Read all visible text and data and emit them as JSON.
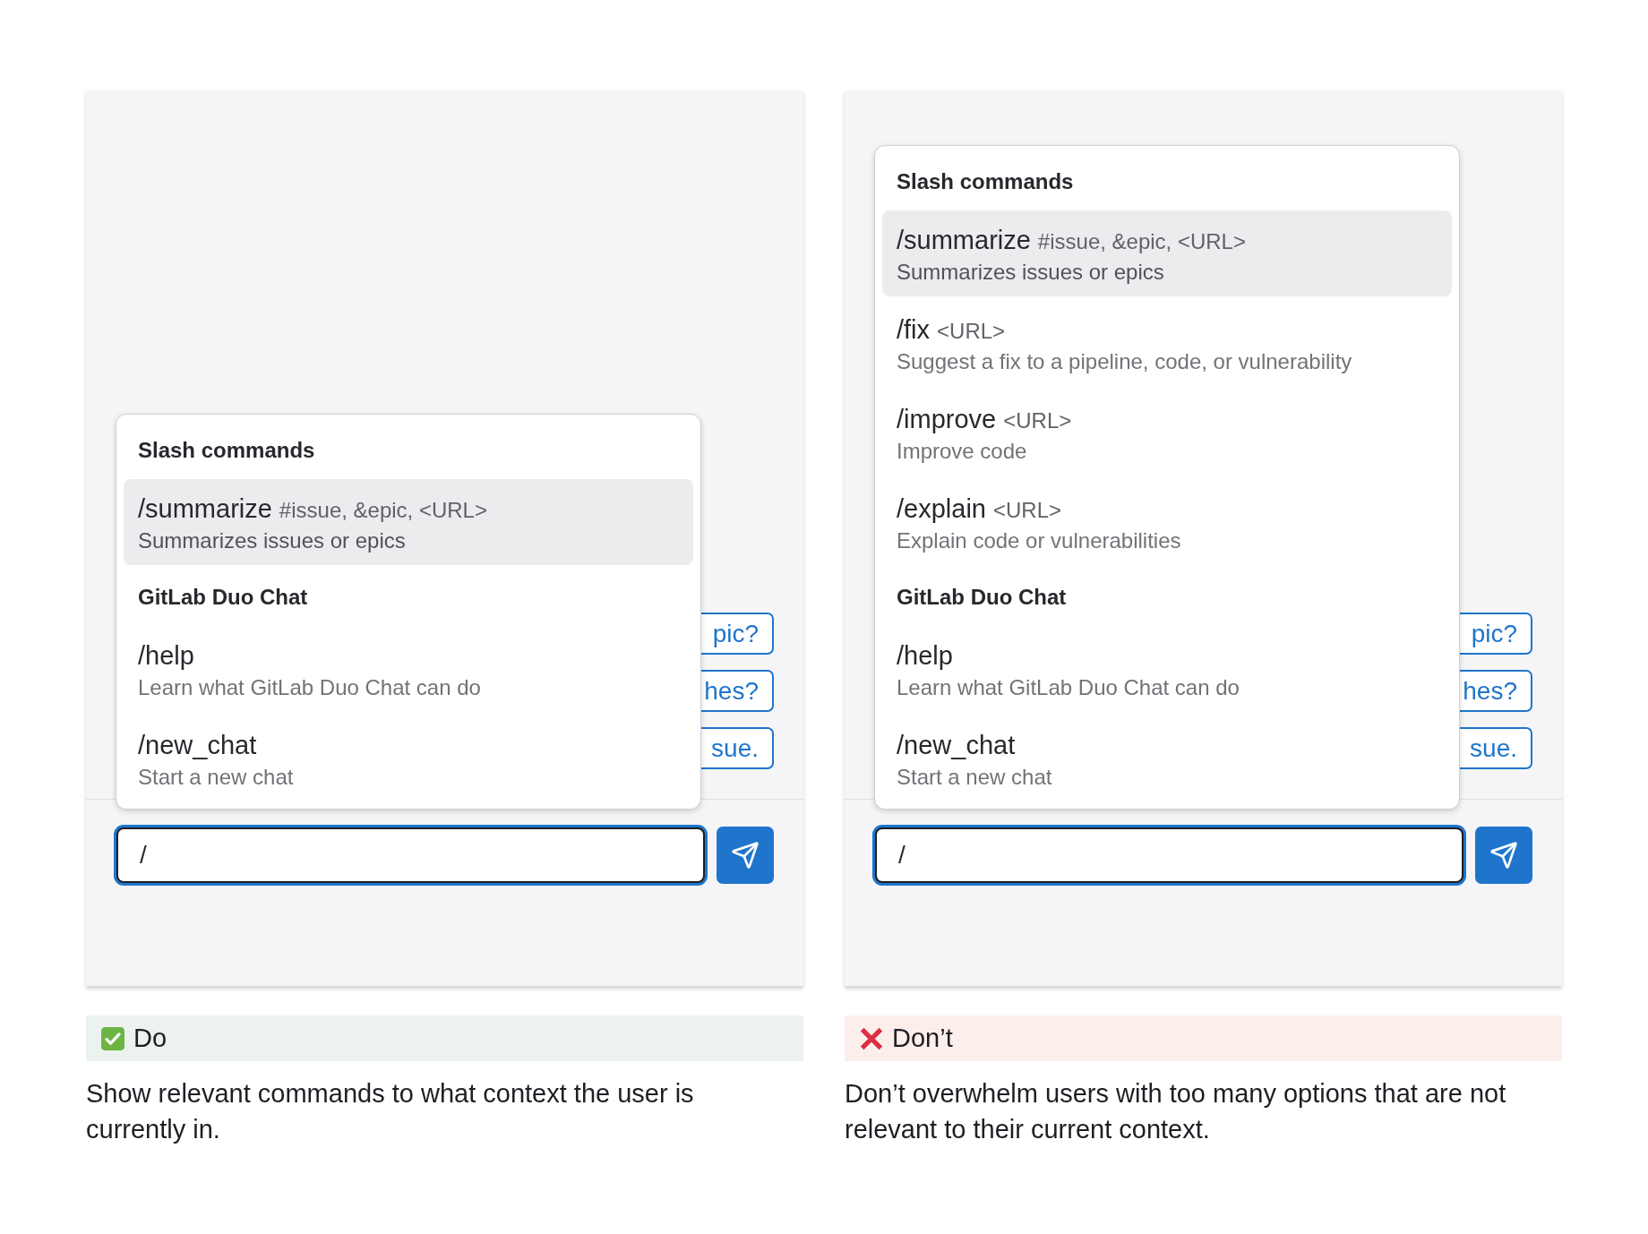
{
  "panels": [
    {
      "popup": {
        "groups": [
          {
            "title": "Slash commands",
            "items": [
              {
                "command": "/summarize",
                "args": "#issue, &epic, <URL>",
                "description": "Summarizes issues or epics",
                "selected": true
              }
            ]
          },
          {
            "title": "GitLab Duo Chat",
            "items": [
              {
                "command": "/help",
                "description": "Learn what GitLab Duo Chat can do",
                "selected": false
              },
              {
                "command": "/new_chat",
                "description": "Start a new chat",
                "selected": false
              }
            ]
          }
        ]
      },
      "suggestions": [
        "pic?",
        "hes?",
        "sue."
      ],
      "input": {
        "value": "/",
        "focused": true
      },
      "verdict": {
        "kind": "do",
        "label": "Do"
      },
      "description": "Show relevant commands to what context the user is currently in."
    },
    {
      "popup": {
        "groups": [
          {
            "title": "Slash commands",
            "items": [
              {
                "command": "/summarize",
                "args": "#issue, &epic, <URL>",
                "description": "Summarizes issues or epics",
                "selected": true
              },
              {
                "command": "/fix",
                "args": "<URL>",
                "description": "Suggest a fix to a pipeline, code, or vulnerability",
                "selected": false
              },
              {
                "command": "/improve",
                "args": "<URL>",
                "description": "Improve code",
                "selected": false
              },
              {
                "command": "/explain",
                "args": "<URL>",
                "description": "Explain code or vulnerabilities",
                "selected": false
              }
            ]
          },
          {
            "title": "GitLab Duo Chat",
            "items": [
              {
                "command": "/help",
                "description": "Learn what GitLab Duo Chat can do",
                "selected": false
              },
              {
                "command": "/new_chat",
                "description": "Start a new chat",
                "selected": false
              }
            ]
          }
        ]
      },
      "suggestions": [
        "pic?",
        "hes?",
        "sue."
      ],
      "input": {
        "value": "/",
        "focused": true
      },
      "verdict": {
        "kind": "dont",
        "label": "Don’t"
      },
      "description": "Don’t overwhelm users with too many options that are not relevant to their current context."
    }
  ]
}
